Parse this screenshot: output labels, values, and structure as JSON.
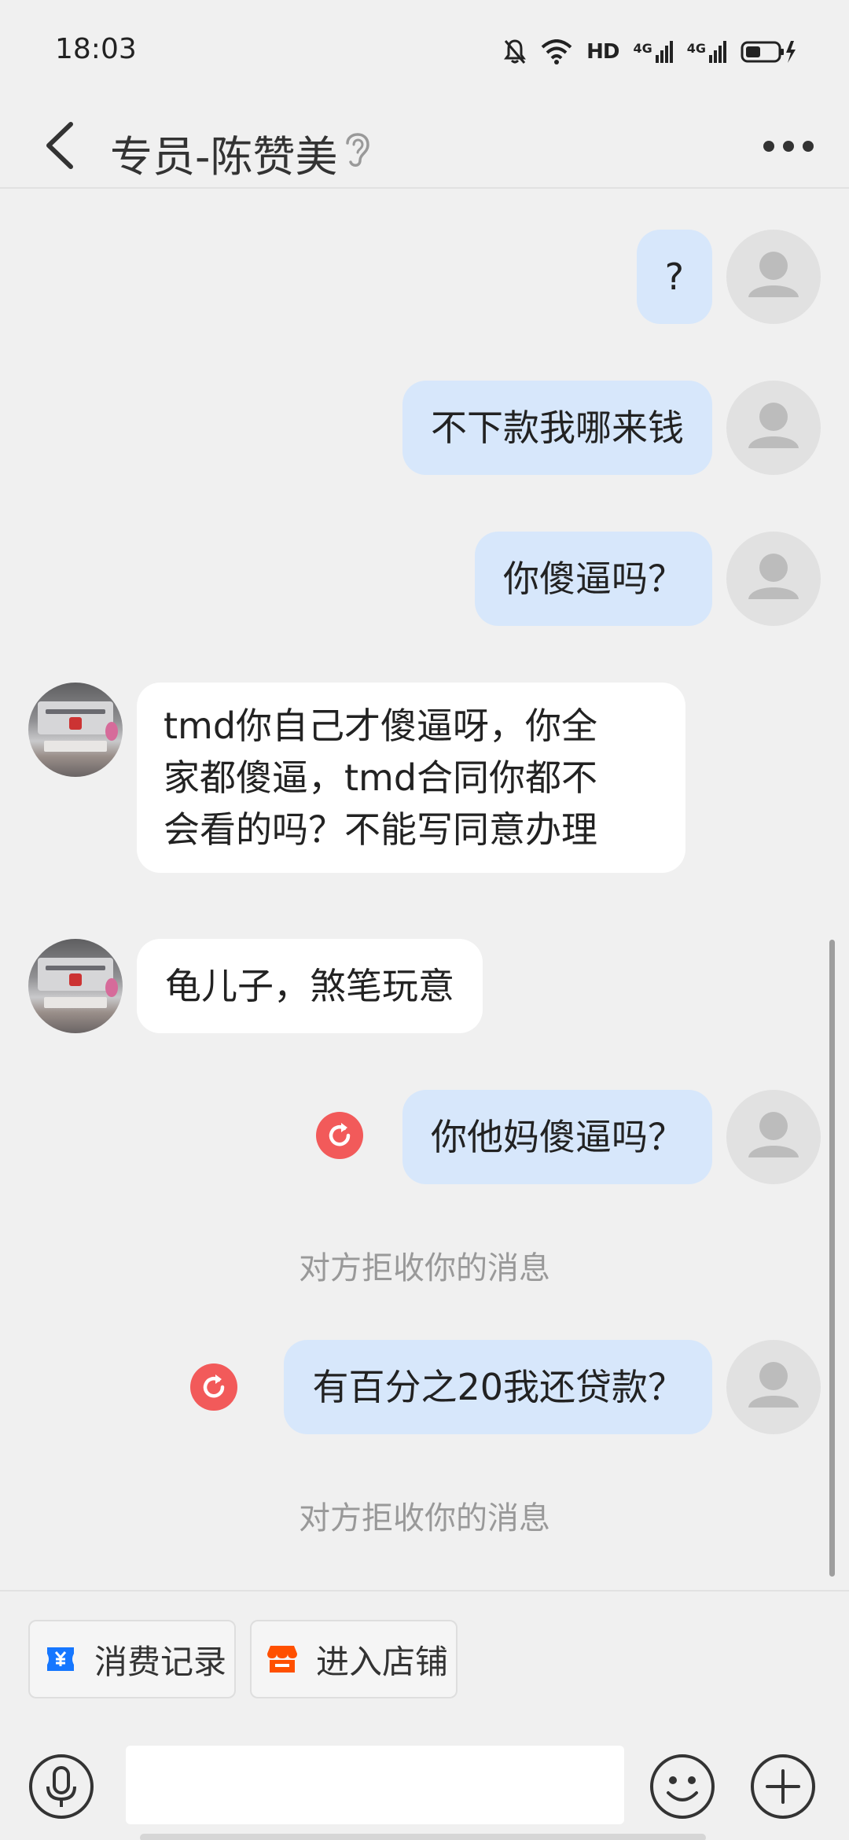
{
  "status_bar": {
    "time": "18:03",
    "icons": [
      "mute-bell-icon",
      "wifi-icon",
      "hd-voice-icon",
      "signal-4g-icon",
      "signal-4g-icon",
      "battery-charging-icon"
    ],
    "hd_label": "HD",
    "net_label": "4G"
  },
  "header": {
    "title": "专员-陈赞美",
    "icons": [
      "back-icon",
      "ear-icon",
      "more-icon"
    ]
  },
  "messages": [
    {
      "id": 1,
      "direction": "out",
      "text": "?",
      "failed": false
    },
    {
      "id": 2,
      "direction": "out",
      "text": "不下款我哪来钱",
      "failed": false
    },
    {
      "id": 3,
      "direction": "out",
      "text": "你傻逼吗？",
      "failed": false
    },
    {
      "id": 4,
      "direction": "in",
      "lines": [
        "tmd你自己才傻逼呀，你全",
        "家都傻逼，tmd合同你都不",
        "会看的吗？不能写同意办理"
      ]
    },
    {
      "id": 5,
      "direction": "in",
      "text": "龟儿子，煞笔玩意"
    },
    {
      "id": 6,
      "direction": "out",
      "text": "你他妈傻逼吗？",
      "failed": true
    },
    {
      "id": 7,
      "direction": "system",
      "text": "对方拒收你的消息"
    },
    {
      "id": 8,
      "direction": "out",
      "text": "有百分之20我还贷款？",
      "failed": true
    },
    {
      "id": 9,
      "direction": "system",
      "text": "对方拒收你的消息"
    }
  ],
  "quick_actions": [
    {
      "label": "消费记录",
      "icon": "receipt-yen-icon",
      "color": "#1677ff"
    },
    {
      "label": "进入店铺",
      "icon": "store-icon",
      "color": "#ff5000"
    }
  ],
  "input_bar": {
    "placeholder": "",
    "icons": [
      "voice-icon",
      "emoji-icon",
      "plus-icon"
    ]
  },
  "colors": {
    "background": "#f0f0f0",
    "outgoing_bubble": "#d7e7fb",
    "incoming_bubble": "#ffffff",
    "fail_red": "#f25a5a",
    "notice_text": "#999999"
  }
}
